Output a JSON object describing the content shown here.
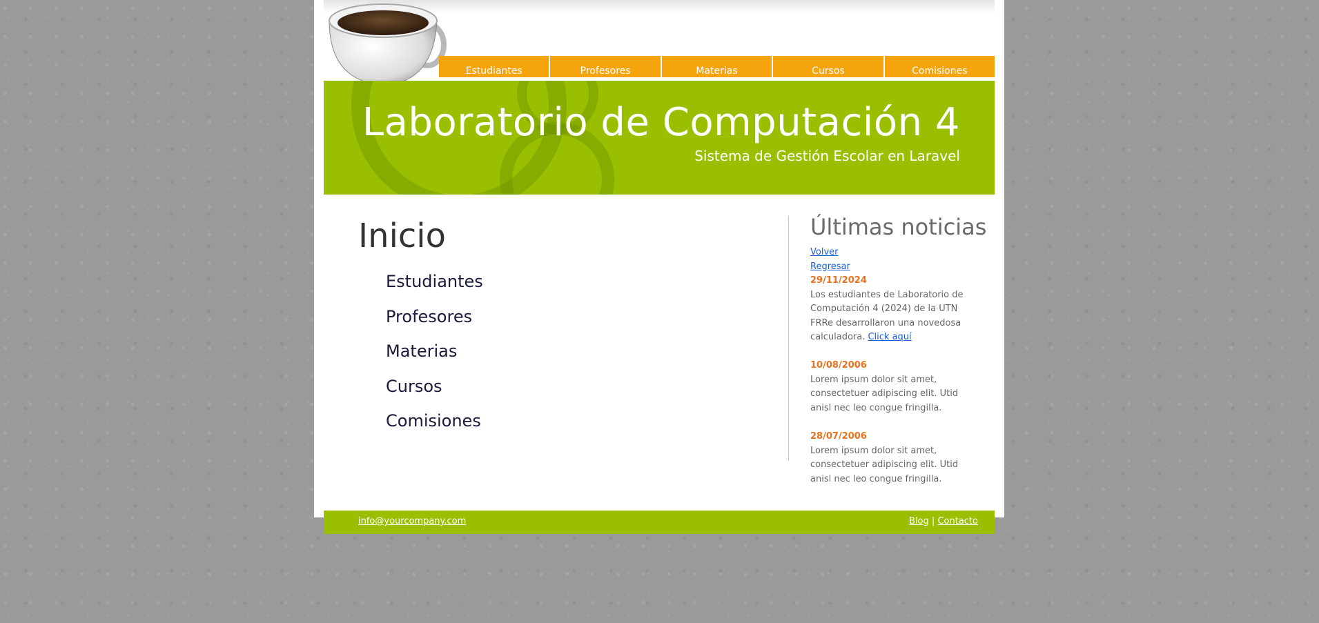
{
  "nav": {
    "items": [
      {
        "label": "Estudiantes"
      },
      {
        "label": "Profesores"
      },
      {
        "label": "Materias"
      },
      {
        "label": "Cursos"
      },
      {
        "label": "Comisiones"
      }
    ]
  },
  "banner": {
    "title": "Laboratorio de Computación 4",
    "subtitle": "Sistema de Gestión Escolar en Laravel"
  },
  "main": {
    "title": "Inicio",
    "links": [
      {
        "label": "Estudiantes"
      },
      {
        "label": "Profesores"
      },
      {
        "label": "Materias"
      },
      {
        "label": "Cursos"
      },
      {
        "label": "Comisiones"
      }
    ]
  },
  "sidebar": {
    "title": "Últimas noticias",
    "volver": "Volver",
    "regresar": "Regresar",
    "news": [
      {
        "date": "29/11/2024",
        "text": "Los estudiantes de Laboratorio de Computación 4 (2024) de la UTN FRRe desarrollaron una novedosa calculadora.",
        "link": "Click aquí"
      },
      {
        "date": "10/08/2006",
        "text": "Lorem ipsum dolor sit amet, consectetuer adipiscing elit. Utid anisl nec leo congue fringilla."
      },
      {
        "date": "28/07/2006",
        "text": "Lorem ipsum dolor sit amet, consectetuer adipiscing elit. Utid anisl nec leo congue fringilla."
      }
    ]
  },
  "footer": {
    "email": "info@yourcompany.com",
    "blog": "Blog",
    "separator": "|",
    "contact": "Contacto"
  },
  "colors": {
    "nav": "#f5a40d",
    "banner": "#9abe00",
    "news_date": "#e8721c",
    "link": "#1a5fd0"
  },
  "icons": {
    "logo": "coffee-cup-icon"
  }
}
